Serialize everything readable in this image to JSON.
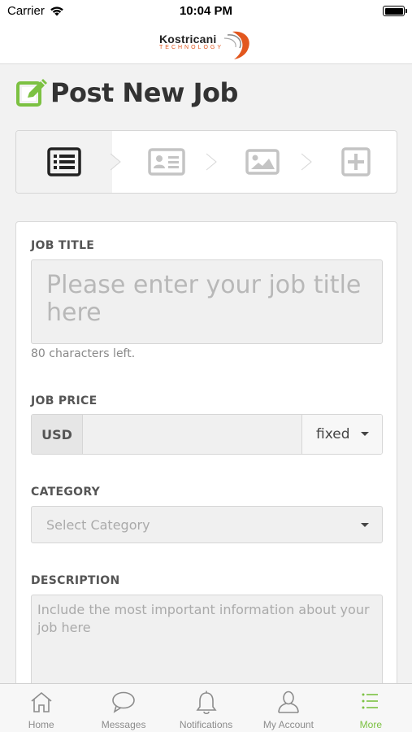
{
  "status_bar": {
    "carrier": "Carrier",
    "time": "10:04 PM"
  },
  "header": {
    "logo_text": "Kostricani",
    "logo_sub": "TECHNOLOGY"
  },
  "page": {
    "title": "Post New Job"
  },
  "steps": [
    {
      "icon": "list-icon",
      "active": true
    },
    {
      "icon": "id-card-icon",
      "active": false
    },
    {
      "icon": "image-icon",
      "active": false
    },
    {
      "icon": "plus-square-icon",
      "active": false
    }
  ],
  "form": {
    "job_title": {
      "label": "JOB TITLE",
      "placeholder": "Please enter your job title here",
      "hint": "80 characters left."
    },
    "job_price": {
      "label": "JOB PRICE",
      "currency": "USD",
      "value": "",
      "type_selected": "fixed"
    },
    "category": {
      "label": "CATEGORY",
      "placeholder": "Select Category"
    },
    "description": {
      "label": "DESCRIPTION",
      "placeholder": "Include the most important information about your job here"
    }
  },
  "tabs": [
    {
      "label": "Home",
      "icon": "home-icon",
      "active": false
    },
    {
      "label": "Messages",
      "icon": "chat-bubble-icon",
      "active": false
    },
    {
      "label": "Notifications",
      "icon": "bell-icon",
      "active": false
    },
    {
      "label": "My Account",
      "icon": "user-icon",
      "active": false
    },
    {
      "label": "More",
      "icon": "menu-list-icon",
      "active": true
    }
  ],
  "colors": {
    "accent": "#7cc142",
    "brand_orange": "#e2571e",
    "title": "#333333"
  }
}
